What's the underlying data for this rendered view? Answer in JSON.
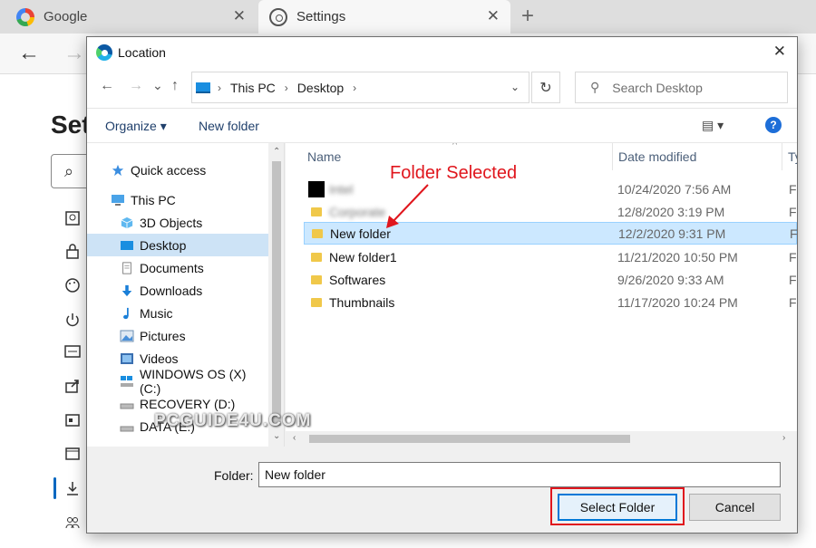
{
  "browser": {
    "tabs": [
      {
        "label": "Google",
        "icon": "google-icon",
        "close": "✕"
      },
      {
        "label": "Settings",
        "icon": "gear-icon",
        "close": "✕"
      }
    ],
    "new_tab": "+",
    "nav_back": "←",
    "nav_forward": "→"
  },
  "settings": {
    "heading": "Set",
    "search_icon": "⌕",
    "sidebar_icons": [
      "profile-icon",
      "privacy-icon",
      "appearance-icon",
      "startup-icon",
      "newtab-icon",
      "share-icon",
      "cookies-icon",
      "defaultbrowser-icon",
      "downloads-icon",
      "family-icon"
    ]
  },
  "dialog": {
    "title": "Location",
    "close": "✕",
    "nav": {
      "back": "←",
      "forward": "→",
      "recent": "⌄",
      "up": "↑"
    },
    "breadcrumb": [
      "This PC",
      "Desktop"
    ],
    "search_placeholder": "Search Desktop",
    "commands": {
      "organize": "Organize ▾",
      "new_folder": "New folder",
      "view": "▤ ▾",
      "help": "?"
    },
    "nav_pane": [
      {
        "label": "Quick access",
        "icon": "star-icon",
        "selected": false
      },
      {
        "label": "This PC",
        "icon": "pc-icon",
        "selected": false
      },
      {
        "label": "3D Objects",
        "icon": "cube-icon",
        "selected": false
      },
      {
        "label": "Desktop",
        "icon": "desktop-icon",
        "selected": true
      },
      {
        "label": "Documents",
        "icon": "document-icon",
        "selected": false
      },
      {
        "label": "Downloads",
        "icon": "download-icon",
        "selected": false
      },
      {
        "label": "Music",
        "icon": "music-icon",
        "selected": false
      },
      {
        "label": "Pictures",
        "icon": "picture-icon",
        "selected": false
      },
      {
        "label": "Videos",
        "icon": "video-icon",
        "selected": false
      },
      {
        "label": "WINDOWS OS (X) (C:)",
        "icon": "drive-c-icon",
        "selected": false
      },
      {
        "label": "RECOVERY (D:)",
        "icon": "drive-icon",
        "selected": false
      },
      {
        "label": "DATA (E:)",
        "icon": "drive-icon",
        "selected": false
      }
    ],
    "columns": {
      "name": "Name",
      "date": "Date modified",
      "type": "Ty"
    },
    "files": [
      {
        "name": "Intel",
        "date": "10/24/2020 7:56 AM",
        "type": "Fi",
        "blurred": true,
        "icon": "black"
      },
      {
        "name": "Corporate",
        "date": "12/8/2020 3:19 PM",
        "type": "Fi",
        "blurred": true,
        "icon": "folder"
      },
      {
        "name": "New folder",
        "date": "12/2/2020 9:31 PM",
        "type": "Fi",
        "blurred": false,
        "icon": "folder",
        "selected": true
      },
      {
        "name": "New folder1",
        "date": "11/21/2020 10:50 PM",
        "type": "Fi",
        "blurred": false,
        "icon": "folder"
      },
      {
        "name": "Softwares",
        "date": "9/26/2020 9:33 AM",
        "type": "Fi",
        "blurred": false,
        "icon": "folder"
      },
      {
        "name": "Thumbnails",
        "date": "11/17/2020 10:24 PM",
        "type": "Fi",
        "blurred": false,
        "icon": "folder"
      }
    ],
    "annotation": "Folder Selected",
    "folder_label": "Folder:",
    "folder_value": "New folder",
    "select_button": "Select Folder",
    "cancel_button": "Cancel",
    "accent_color": "#0078d7",
    "highlight_color": "#e0161d"
  },
  "watermark": "PCGUIDE4U.COM"
}
